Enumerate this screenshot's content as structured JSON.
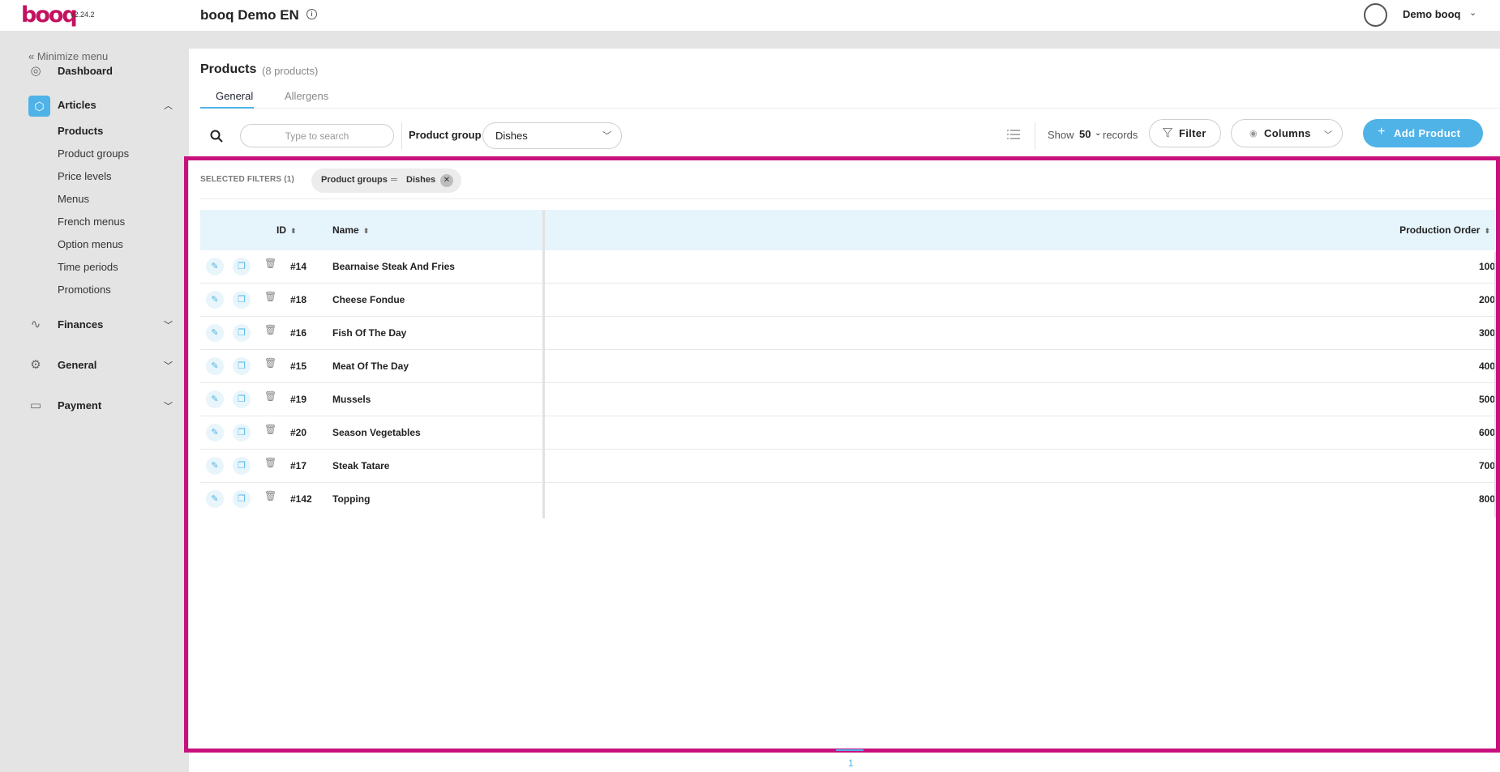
{
  "topbar": {
    "logo": "booq",
    "version": "v2.24.2",
    "venue": "booq Demo EN",
    "info_icon": "i",
    "user": "Demo booq"
  },
  "sidebar": {
    "minimize": "« Minimize menu",
    "dashboard": "Dashboard",
    "articles": "Articles",
    "articles_sub": [
      "Products",
      "Product groups",
      "Price levels",
      "Menus",
      "French menus",
      "Option menus",
      "Time periods",
      "Promotions"
    ],
    "finances": "Finances",
    "general": "General",
    "payment": "Payment"
  },
  "page": {
    "title": "Products",
    "count": "(8 products)",
    "tabs": [
      "General",
      "Allergens"
    ]
  },
  "toolbar": {
    "search_placeholder": "Type to search",
    "product_group_label": "Product group",
    "product_group_value": "Dishes",
    "show_label": "Show",
    "show_value": "50",
    "records_label": "records",
    "filter_label": "Filter",
    "columns_label": "Columns",
    "add_label": "Add Product"
  },
  "filters": {
    "title": "SELECTED FILTERS (1)",
    "chip_field": "Product groups",
    "chip_value": "Dishes"
  },
  "table": {
    "headers": {
      "id": "ID",
      "name": "Name",
      "production_order": "Production Order"
    },
    "rows": [
      {
        "id": "#14",
        "name": "Bearnaise Steak And Fries",
        "production_order": "100"
      },
      {
        "id": "#18",
        "name": "Cheese Fondue",
        "production_order": "200"
      },
      {
        "id": "#16",
        "name": "Fish Of The Day",
        "production_order": "300"
      },
      {
        "id": "#15",
        "name": "Meat Of The Day",
        "production_order": "400"
      },
      {
        "id": "#19",
        "name": "Mussels",
        "production_order": "500"
      },
      {
        "id": "#20",
        "name": "Season Vegetables",
        "production_order": "600"
      },
      {
        "id": "#17",
        "name": "Steak Tatare",
        "production_order": "700"
      },
      {
        "id": "#142",
        "name": "Topping",
        "production_order": "800"
      }
    ]
  },
  "pagination": {
    "current": "1"
  },
  "colors": {
    "accent": "#4fb3e8",
    "brand": "#c4125f",
    "highlight": "#c8117d"
  },
  "icons": {
    "edit": "pencil-icon",
    "copy": "copy-icon",
    "delete": "trash-icon"
  }
}
